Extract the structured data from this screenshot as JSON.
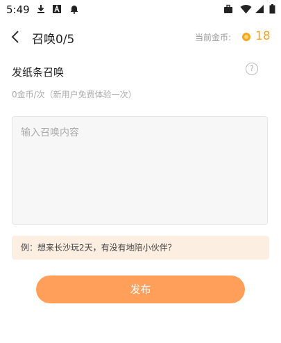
{
  "status_bar": {
    "time": "5:49",
    "icons": [
      "download-icon",
      "a-badge-icon",
      "notification-bell-icon",
      "briefcase-icon",
      "wifi-icon",
      "signal-icon",
      "battery-icon"
    ]
  },
  "header": {
    "title": "召唤0/5",
    "coin_label": "当前金币:",
    "coin_value": "18"
  },
  "section": {
    "title": "发纸条召唤",
    "help_glyph": "?",
    "price_note": "0金币/次（新用户免费体验一次）"
  },
  "input": {
    "placeholder": "输入召唤内容",
    "value": ""
  },
  "example": {
    "text": "例：想来长沙玩2天，有没有地陪小伙伴？"
  },
  "publish_button": {
    "label": "发布"
  },
  "colors": {
    "accent": "#f5a623",
    "button": "#ff9f5a",
    "example_bg": "#fdeee2"
  }
}
